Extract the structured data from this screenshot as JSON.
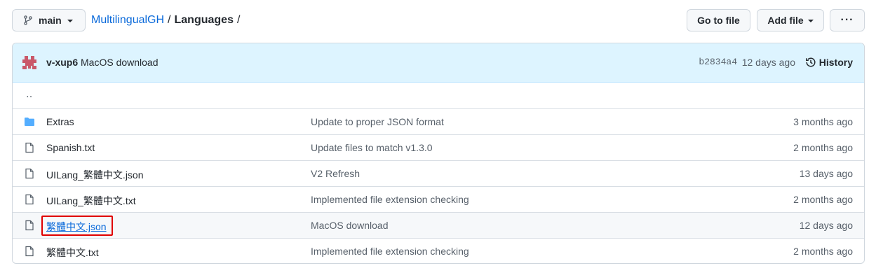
{
  "toolbar": {
    "branch": "main",
    "breadcrumb": {
      "repo": "MultilingualGH",
      "sep1": "/",
      "folder": "Languages",
      "sep2": "/"
    },
    "goto_file": "Go to file",
    "add_file": "Add file",
    "more": "···"
  },
  "commit": {
    "author": "v-xup6",
    "message": "MacOS download",
    "sha": "b2834a4",
    "time": "12 days ago",
    "history_label": "History"
  },
  "parent_dir": "‥",
  "files": [
    {
      "name": "Extras",
      "type": "folder",
      "message": "Update to proper JSON format",
      "time": "3 months ago"
    },
    {
      "name": "Spanish.txt",
      "type": "file",
      "message": "Update files to match v1.3.0",
      "time": "2 months ago"
    },
    {
      "name": "UILang_繁體中文.json",
      "type": "file",
      "message": "V2 Refresh",
      "time": "13 days ago"
    },
    {
      "name": "UILang_繁體中文.txt",
      "type": "file",
      "message": "Implemented file extension checking",
      "time": "2 months ago"
    },
    {
      "name": "繁體中文.json",
      "type": "file",
      "message": "MacOS download",
      "time": "12 days ago",
      "highlighted": true
    },
    {
      "name": "繁體中文.txt",
      "type": "file",
      "message": "Implemented file extension checking",
      "time": "2 months ago"
    }
  ],
  "colors": {
    "link": "#0969da",
    "folder_icon": "#54aeff",
    "commit_bar_bg": "#ddf4ff",
    "highlight_border": "#e00000"
  }
}
